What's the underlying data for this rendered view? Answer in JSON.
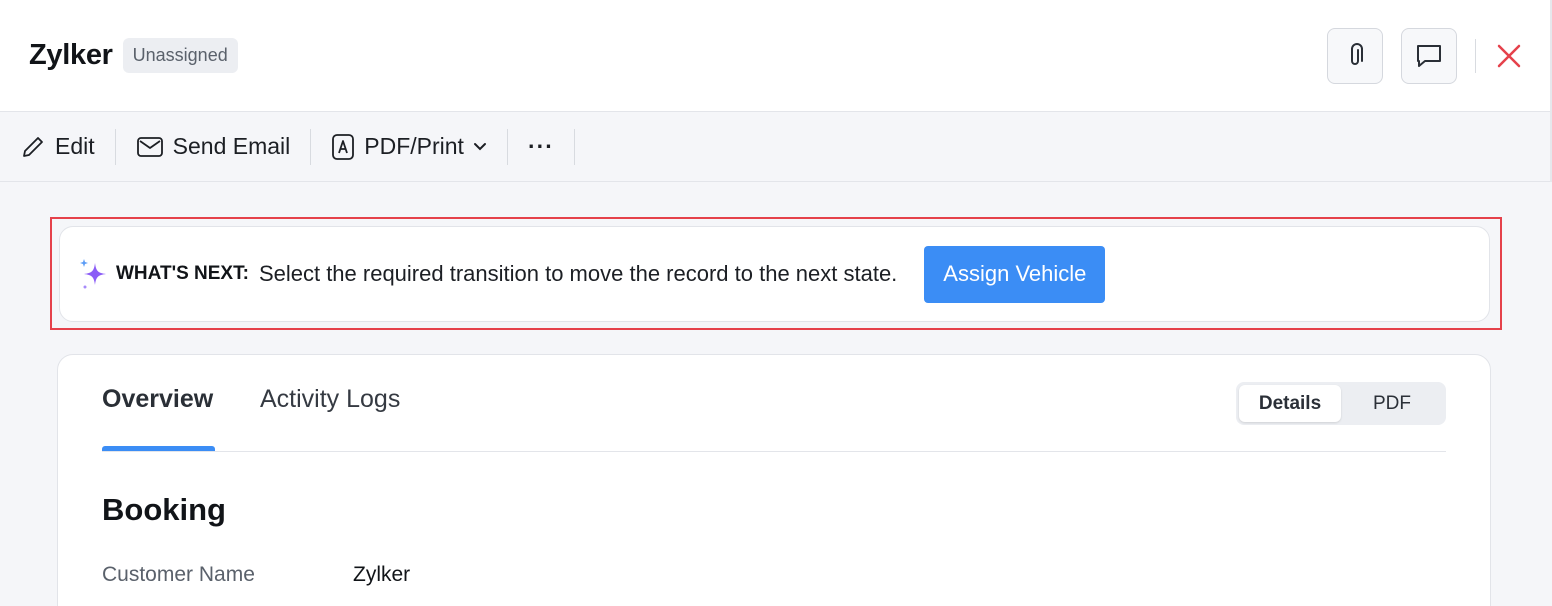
{
  "header": {
    "title": "Zylker",
    "status": "Unassigned"
  },
  "toolbar": {
    "edit_label": "Edit",
    "send_email_label": "Send Email",
    "pdf_print_label": "PDF/Print",
    "more_label": "···"
  },
  "whats_next": {
    "label": "WHAT'S NEXT:",
    "message": "Select the required transition to move the record to the next state.",
    "button_label": "Assign Vehicle"
  },
  "tabs": [
    {
      "label": "Overview",
      "active": true
    },
    {
      "label": "Activity Logs",
      "active": false
    }
  ],
  "view_toggle": {
    "details_label": "Details",
    "pdf_label": "PDF",
    "selected": "Details"
  },
  "section": {
    "title": "Booking",
    "fields": [
      {
        "label": "Customer Name",
        "value": "Zylker"
      }
    ]
  },
  "colors": {
    "accent": "#3b8df5",
    "highlight": "#e5414b",
    "close": "#e5414b",
    "sparkle": "#8b5cf6"
  }
}
